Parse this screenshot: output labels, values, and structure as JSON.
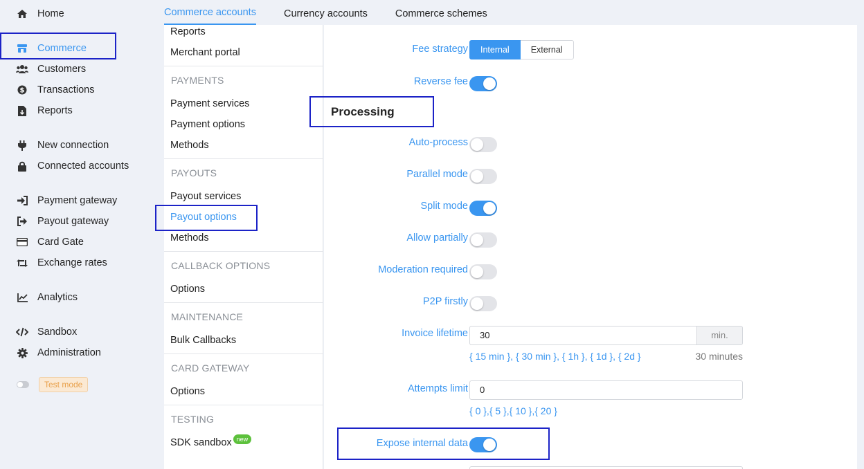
{
  "sidebar": {
    "items": [
      {
        "label": "Home",
        "icon": "home-icon"
      },
      {
        "label": "Commerce",
        "icon": "store-icon"
      },
      {
        "label": "Customers",
        "icon": "users-icon"
      },
      {
        "label": "Transactions",
        "icon": "dollar-icon"
      },
      {
        "label": "Reports",
        "icon": "file-icon"
      },
      {
        "label": "New connection",
        "icon": "plug-icon"
      },
      {
        "label": "Connected accounts",
        "icon": "lock-icon"
      },
      {
        "label": "Payment gateway",
        "icon": "sign-in-icon"
      },
      {
        "label": "Payout gateway",
        "icon": "sign-out-icon"
      },
      {
        "label": "Card Gate",
        "icon": "card-icon"
      },
      {
        "label": "Exchange rates",
        "icon": "retweet-icon"
      },
      {
        "label": "Analytics",
        "icon": "chart-icon"
      },
      {
        "label": "Sandbox",
        "icon": "code-icon"
      },
      {
        "label": "Administration",
        "icon": "gear-icon"
      }
    ],
    "test_mode_label": "Test mode"
  },
  "tabs": [
    "Commerce accounts",
    "Currency accounts",
    "Commerce schemes"
  ],
  "submenu": {
    "top_items": [
      "Reports",
      "Merchant portal"
    ],
    "payments": {
      "heading": "PAYMENTS",
      "items": [
        "Payment services",
        "Payment options",
        "Methods"
      ]
    },
    "payouts": {
      "heading": "PAYOUTS",
      "items": [
        "Payout services",
        "Payout options",
        "Methods"
      ]
    },
    "callback": {
      "heading": "CALLBACK OPTIONS",
      "items": [
        "Options"
      ]
    },
    "maintenance": {
      "heading": "MAINTENANCE",
      "items": [
        "Bulk Callbacks"
      ]
    },
    "card_gateway": {
      "heading": "CARD GATEWAY",
      "items": [
        "Options"
      ]
    },
    "testing": {
      "heading": "TESTING",
      "items": [
        "SDK sandbox"
      ],
      "new_badge": "new"
    }
  },
  "form": {
    "fee_strategy": {
      "label": "Fee strategy",
      "options": [
        "Internal",
        "External"
      ],
      "selected": "Internal"
    },
    "reverse_fee": {
      "label": "Reverse fee",
      "value": true
    },
    "section_title": "Processing",
    "auto_process": {
      "label": "Auto-process",
      "value": false
    },
    "parallel_mode": {
      "label": "Parallel mode",
      "value": false
    },
    "split_mode": {
      "label": "Split mode",
      "value": true
    },
    "allow_partially": {
      "label": "Allow partially",
      "value": false
    },
    "moderation_required": {
      "label": "Moderation required",
      "value": false
    },
    "p2p_firstly": {
      "label": "P2P firstly",
      "value": false
    },
    "invoice_lifetime": {
      "label": "Invoice lifetime",
      "value": "30",
      "unit": "min.",
      "presets": [
        "{ 15 min }",
        "{ 30 min }",
        "{ 1h }",
        "{ 1d }",
        "{ 2d }"
      ],
      "hint": "30 minutes"
    },
    "attempts_limit": {
      "label": "Attempts limit",
      "value": "0",
      "presets": [
        "{ 0 }",
        "{ 5 }",
        "{ 10 }",
        "{ 20 }"
      ]
    },
    "expose_internal_data": {
      "label": "Expose internal data",
      "value": true
    }
  },
  "colors": {
    "accent": "#3a96f0",
    "highlight_border": "#1c23c7",
    "new_badge": "#5dc13c"
  }
}
